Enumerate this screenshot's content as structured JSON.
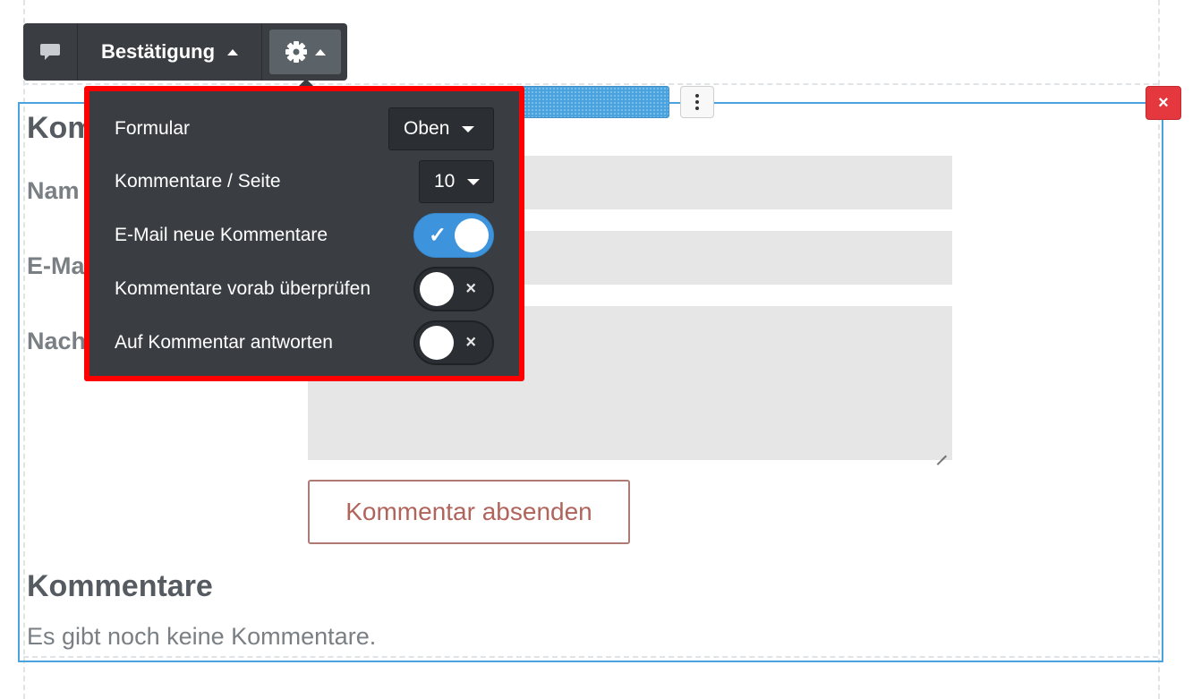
{
  "toolbar": {
    "chat_icon": "comment-icon",
    "mode_label": "Bestätigung",
    "settings_icon": "gear-icon"
  },
  "settings": {
    "form_label": "Formular",
    "form_value": "Oben",
    "per_page_label": "Kommentare / Seite",
    "per_page_value": "10",
    "email_label": "E-Mail neue Kommentare",
    "email_on": true,
    "moderate_label": "Kommentare vorab überprüfen",
    "moderate_on": false,
    "reply_label": "Auf Kommentar antworten",
    "reply_on": false,
    "check_mark": "✓",
    "cross_mark": "×"
  },
  "widget": {
    "title": "Kom",
    "name_label": "Nam",
    "email_label": "E-Ma",
    "message_label": "Nach",
    "submit_label": "Kommentar absenden",
    "comments_heading": "Kommentare",
    "empty_text": "Es gibt noch keine Kommentare.",
    "close_symbol": "×"
  },
  "colors": {
    "accent": "#4aa3df",
    "panel_bg": "#3a3e42",
    "highlight": "#ff0000",
    "danger": "#e5373e",
    "submit_text": "#b0645c"
  }
}
